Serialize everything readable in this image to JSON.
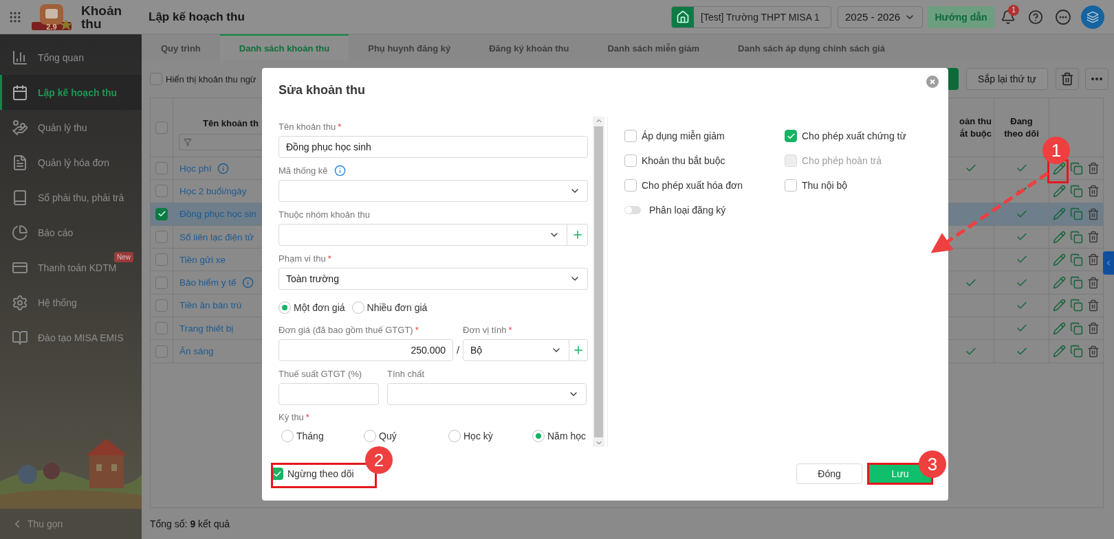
{
  "header": {
    "logo_badge": "2.9",
    "app_name": "Khoản thu",
    "page_title": "Lập kế hoạch thu",
    "school": "[Test] Trường THPT MISA 1",
    "year": "2025 - 2026",
    "guide_button": "Hướng dẫn",
    "notification_count": "1"
  },
  "sidebar": {
    "items": [
      {
        "label": "Tổng quan",
        "selected": false
      },
      {
        "label": "Lập kế hoạch thu",
        "selected": true
      },
      {
        "label": "Quản lý thu",
        "selected": false
      },
      {
        "label": "Quản lý hóa đơn",
        "selected": false
      },
      {
        "label": "Sổ phải thu, phải trả",
        "selected": false
      },
      {
        "label": "Báo cáo",
        "selected": false
      },
      {
        "label": "Thanh toán KDTM",
        "selected": false,
        "badge": "New"
      },
      {
        "label": "Hệ thống",
        "selected": false
      },
      {
        "label": "Đào tạo MISA EMIS",
        "selected": false
      }
    ],
    "collapse": "Thu gọn"
  },
  "tabs": [
    {
      "label": "Quy trình",
      "selected": false
    },
    {
      "label": "Danh sách khoản thu",
      "selected": true
    },
    {
      "label": "Phụ huynh đăng ký",
      "selected": false
    },
    {
      "label": "Đăng ký khoản thu",
      "selected": false
    },
    {
      "label": "Danh sách miễn giảm",
      "selected": false
    },
    {
      "label": "Danh sách áp dụng chính sách giá",
      "selected": false
    }
  ],
  "toolbar": {
    "show_stopped": {
      "label": "Hiển thị khoản thu ngừ",
      "checked": false
    },
    "reorder_button": "Sắp lại thứ tự"
  },
  "table": {
    "select_all": false,
    "columns": [
      {
        "label": "Tên khoản th"
      },
      {
        "label": "oản thu ắt buộc"
      },
      {
        "label": "Đang theo dõi"
      }
    ],
    "rows": [
      {
        "name": "Học phí",
        "info": true,
        "selected": false,
        "required": true,
        "tracking": true
      },
      {
        "name": "Học 2 buổi/ngày",
        "info": false,
        "selected": false,
        "required": false,
        "tracking": true
      },
      {
        "name": "Đồng phục học sin",
        "info": false,
        "selected": true,
        "required": false,
        "tracking": true
      },
      {
        "name": "Sổ liên lạc điện tử",
        "info": false,
        "selected": false,
        "required": false,
        "tracking": true
      },
      {
        "name": "Tiền gửi xe",
        "info": false,
        "selected": false,
        "required": false,
        "tracking": true
      },
      {
        "name": "Bảo hiểm y tế",
        "info": true,
        "selected": false,
        "required": true,
        "tracking": true
      },
      {
        "name": "Tiền ăn bán trú",
        "info": false,
        "selected": false,
        "required": false,
        "tracking": true
      },
      {
        "name": "Trang thiết bị",
        "info": false,
        "selected": false,
        "required": false,
        "tracking": true
      },
      {
        "name": "Ăn sáng",
        "info": false,
        "selected": false,
        "required": true,
        "tracking": true
      }
    ],
    "total": "Tổng số: **9** kết quả"
  },
  "modal": {
    "title": "Sửa khoản thu",
    "name_field": {
      "label": "Tên khoản thu",
      "required_mark": "*",
      "value": "Đồng phục học sinh"
    },
    "stat_code": {
      "label": "Mã thống kê"
    },
    "group": {
      "label": "Thuộc nhóm khoản thu"
    },
    "scope": {
      "label": "Phạm vi thu",
      "required_mark": "*",
      "value": "Toàn trường"
    },
    "price_mode": [
      {
        "label": "Một đơn giá",
        "selected": true
      },
      {
        "label": "Nhiều đơn giá",
        "selected": false
      }
    ],
    "price": {
      "label": "Đơn giá (đã bao gồm thuế GTGT)",
      "required_mark": "*",
      "value": "250.000"
    },
    "separator": "/",
    "unit": {
      "label": "Đơn vị tính",
      "required_mark": "*",
      "value": "Bộ"
    },
    "vat": {
      "label": "Thuế suất GTGT (%)"
    },
    "nature": {
      "label": "Tính chất"
    },
    "period": {
      "label": "Kỳ thu",
      "required_mark": "*",
      "options": [
        {
          "label": "Tháng",
          "selected": false
        },
        {
          "label": "Quý",
          "selected": false
        },
        {
          "label": "Học kỳ",
          "selected": false
        },
        {
          "label": "Năm học",
          "selected": true
        }
      ]
    },
    "options": [
      {
        "kind": "checkbox",
        "label": "Áp dụng miễn giảm",
        "checked": false,
        "disabled": false
      },
      {
        "kind": "checkbox",
        "label": "Cho phép xuất chứng từ",
        "checked": true,
        "disabled": false
      },
      {
        "kind": "checkbox",
        "label": "Khoản thu bắt buộc",
        "checked": false,
        "disabled": false
      },
      {
        "kind": "checkbox",
        "label": "Cho phép hoàn trả",
        "checked": false,
        "disabled": true
      },
      {
        "kind": "checkbox",
        "label": "Cho phép xuất hóa đơn",
        "checked": false,
        "disabled": false
      },
      {
        "kind": "checkbox",
        "label": "Thu nội bộ",
        "checked": false,
        "disabled": false
      },
      {
        "kind": "toggle",
        "label": "Phân loại đăng ký",
        "on": false
      }
    ],
    "stop_tracking": {
      "label": "Ngừng theo dõi",
      "checked": true
    },
    "buttons": [
      {
        "label": "Đóng",
        "kind": "secondary"
      },
      {
        "label": "Lưu",
        "kind": "primary"
      }
    ]
  },
  "annotations": [
    {
      "number": "1"
    },
    {
      "number": "2"
    },
    {
      "number": "3"
    }
  ]
}
